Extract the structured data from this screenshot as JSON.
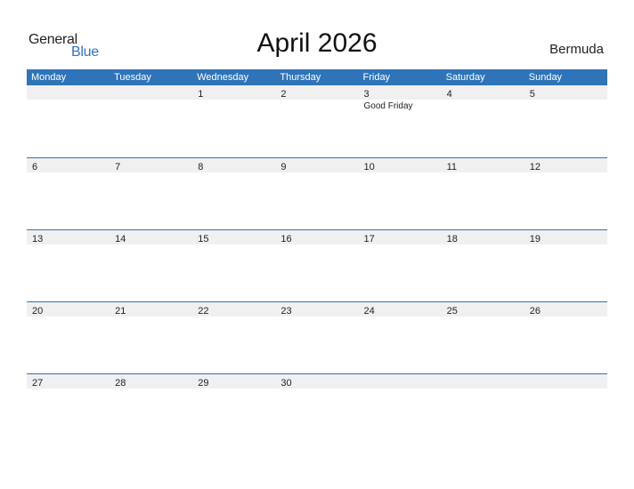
{
  "logo": {
    "word1": "General",
    "word2": "Blue"
  },
  "title": "April 2026",
  "country": "Bermuda",
  "colors": {
    "accent": "#2f74b8",
    "day_strip": "#f0f0f0"
  },
  "weekdays": [
    "Monday",
    "Tuesday",
    "Wednesday",
    "Thursday",
    "Friday",
    "Saturday",
    "Sunday"
  ],
  "weeks": [
    {
      "days": [
        "",
        "",
        "1",
        "2",
        "3",
        "4",
        "5"
      ],
      "events": [
        "",
        "",
        "",
        "",
        "Good Friday",
        "",
        ""
      ]
    },
    {
      "days": [
        "6",
        "7",
        "8",
        "9",
        "10",
        "11",
        "12"
      ],
      "events": [
        "",
        "",
        "",
        "",
        "",
        "",
        ""
      ]
    },
    {
      "days": [
        "13",
        "14",
        "15",
        "16",
        "17",
        "18",
        "19"
      ],
      "events": [
        "",
        "",
        "",
        "",
        "",
        "",
        ""
      ]
    },
    {
      "days": [
        "20",
        "21",
        "22",
        "23",
        "24",
        "25",
        "26"
      ],
      "events": [
        "",
        "",
        "",
        "",
        "",
        "",
        ""
      ]
    },
    {
      "days": [
        "27",
        "28",
        "29",
        "30",
        "",
        "",
        ""
      ],
      "events": [
        "",
        "",
        "",
        "",
        "",
        "",
        ""
      ]
    }
  ]
}
